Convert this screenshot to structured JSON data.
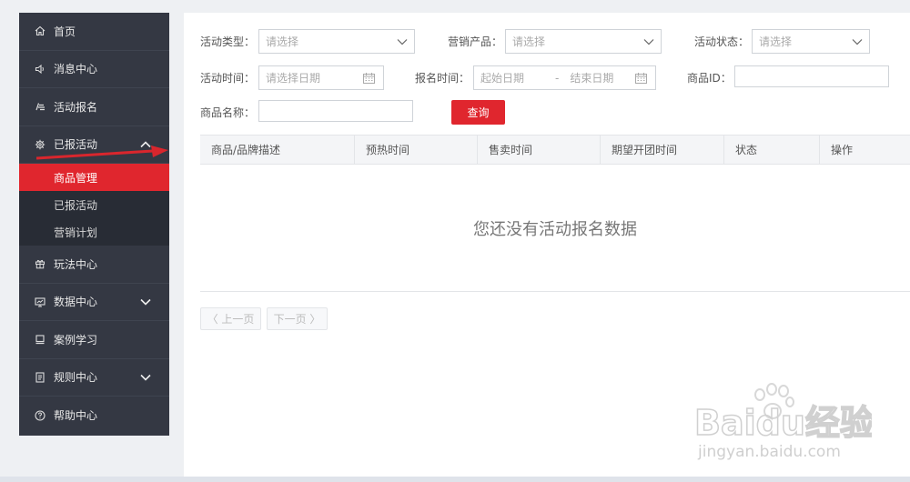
{
  "sidebar": {
    "items": [
      {
        "label": "首页",
        "icon": "home-icon"
      },
      {
        "label": "消息中心",
        "icon": "speaker-icon"
      },
      {
        "label": "活动报名",
        "icon": "edit-icon"
      },
      {
        "label": "已报活动",
        "icon": "gear-icon"
      },
      {
        "label": "玩法中心",
        "icon": "gift-icon"
      },
      {
        "label": "数据中心",
        "icon": "monitor-icon"
      },
      {
        "label": "案例学习",
        "icon": "book-icon"
      },
      {
        "label": "规则中心",
        "icon": "document-icon"
      },
      {
        "label": "帮助中心",
        "icon": "help-icon"
      }
    ],
    "submenu": [
      {
        "label": "商品管理",
        "active": true
      },
      {
        "label": "已报活动",
        "active": false
      },
      {
        "label": "营销计划",
        "active": false
      }
    ]
  },
  "filters": {
    "activity_type": {
      "label": "活动类型：",
      "placeholder": "请选择"
    },
    "marketing_product": {
      "label": "营销产品：",
      "placeholder": "请选择"
    },
    "activity_status": {
      "label": "活动状态：",
      "placeholder": "请选择"
    },
    "activity_time": {
      "label": "活动时间：",
      "placeholder": "请选择日期"
    },
    "signup_time": {
      "label": "报名时间：",
      "start_placeholder": "起始日期",
      "separator": "-",
      "end_placeholder": "结束日期"
    },
    "product_id": {
      "label": "商品ID：",
      "value": ""
    },
    "product_name": {
      "label": "商品名称：",
      "value": ""
    },
    "query_button": "查询"
  },
  "table": {
    "columns": [
      "商品/品牌描述",
      "预热时间",
      "售卖时间",
      "期望开团时间",
      "状态",
      "操作"
    ],
    "empty_text": "您还没有活动报名数据"
  },
  "pagination": {
    "prev": "〈 上一页",
    "next": "下一页 〉"
  },
  "watermark": {
    "brand": "Baidu经验",
    "url": "jingyan.baidu.com"
  },
  "colors": {
    "sidebar_bg": "#343843",
    "submenu_bg": "#282c35",
    "accent_red": "#e0262e"
  }
}
